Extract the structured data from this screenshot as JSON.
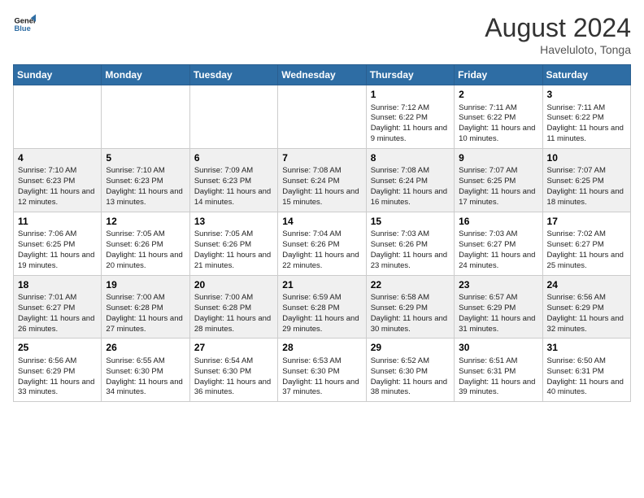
{
  "header": {
    "logo_line1": "General",
    "logo_line2": "Blue",
    "month_year": "August 2024",
    "location": "Haveluloto, Tonga"
  },
  "days_of_week": [
    "Sunday",
    "Monday",
    "Tuesday",
    "Wednesday",
    "Thursday",
    "Friday",
    "Saturday"
  ],
  "weeks": [
    [
      {
        "day": "",
        "info": ""
      },
      {
        "day": "",
        "info": ""
      },
      {
        "day": "",
        "info": ""
      },
      {
        "day": "",
        "info": ""
      },
      {
        "day": "1",
        "info": "Sunrise: 7:12 AM\nSunset: 6:22 PM\nDaylight: 11 hours\nand 9 minutes."
      },
      {
        "day": "2",
        "info": "Sunrise: 7:11 AM\nSunset: 6:22 PM\nDaylight: 11 hours\nand 10 minutes."
      },
      {
        "day": "3",
        "info": "Sunrise: 7:11 AM\nSunset: 6:22 PM\nDaylight: 11 hours\nand 11 minutes."
      }
    ],
    [
      {
        "day": "4",
        "info": "Sunrise: 7:10 AM\nSunset: 6:23 PM\nDaylight: 11 hours\nand 12 minutes."
      },
      {
        "day": "5",
        "info": "Sunrise: 7:10 AM\nSunset: 6:23 PM\nDaylight: 11 hours\nand 13 minutes."
      },
      {
        "day": "6",
        "info": "Sunrise: 7:09 AM\nSunset: 6:23 PM\nDaylight: 11 hours\nand 14 minutes."
      },
      {
        "day": "7",
        "info": "Sunrise: 7:08 AM\nSunset: 6:24 PM\nDaylight: 11 hours\nand 15 minutes."
      },
      {
        "day": "8",
        "info": "Sunrise: 7:08 AM\nSunset: 6:24 PM\nDaylight: 11 hours\nand 16 minutes."
      },
      {
        "day": "9",
        "info": "Sunrise: 7:07 AM\nSunset: 6:25 PM\nDaylight: 11 hours\nand 17 minutes."
      },
      {
        "day": "10",
        "info": "Sunrise: 7:07 AM\nSunset: 6:25 PM\nDaylight: 11 hours\nand 18 minutes."
      }
    ],
    [
      {
        "day": "11",
        "info": "Sunrise: 7:06 AM\nSunset: 6:25 PM\nDaylight: 11 hours\nand 19 minutes."
      },
      {
        "day": "12",
        "info": "Sunrise: 7:05 AM\nSunset: 6:26 PM\nDaylight: 11 hours\nand 20 minutes."
      },
      {
        "day": "13",
        "info": "Sunrise: 7:05 AM\nSunset: 6:26 PM\nDaylight: 11 hours\nand 21 minutes."
      },
      {
        "day": "14",
        "info": "Sunrise: 7:04 AM\nSunset: 6:26 PM\nDaylight: 11 hours\nand 22 minutes."
      },
      {
        "day": "15",
        "info": "Sunrise: 7:03 AM\nSunset: 6:26 PM\nDaylight: 11 hours\nand 23 minutes."
      },
      {
        "day": "16",
        "info": "Sunrise: 7:03 AM\nSunset: 6:27 PM\nDaylight: 11 hours\nand 24 minutes."
      },
      {
        "day": "17",
        "info": "Sunrise: 7:02 AM\nSunset: 6:27 PM\nDaylight: 11 hours\nand 25 minutes."
      }
    ],
    [
      {
        "day": "18",
        "info": "Sunrise: 7:01 AM\nSunset: 6:27 PM\nDaylight: 11 hours\nand 26 minutes."
      },
      {
        "day": "19",
        "info": "Sunrise: 7:00 AM\nSunset: 6:28 PM\nDaylight: 11 hours\nand 27 minutes."
      },
      {
        "day": "20",
        "info": "Sunrise: 7:00 AM\nSunset: 6:28 PM\nDaylight: 11 hours\nand 28 minutes."
      },
      {
        "day": "21",
        "info": "Sunrise: 6:59 AM\nSunset: 6:28 PM\nDaylight: 11 hours\nand 29 minutes."
      },
      {
        "day": "22",
        "info": "Sunrise: 6:58 AM\nSunset: 6:29 PM\nDaylight: 11 hours\nand 30 minutes."
      },
      {
        "day": "23",
        "info": "Sunrise: 6:57 AM\nSunset: 6:29 PM\nDaylight: 11 hours\nand 31 minutes."
      },
      {
        "day": "24",
        "info": "Sunrise: 6:56 AM\nSunset: 6:29 PM\nDaylight: 11 hours\nand 32 minutes."
      }
    ],
    [
      {
        "day": "25",
        "info": "Sunrise: 6:56 AM\nSunset: 6:29 PM\nDaylight: 11 hours\nand 33 minutes."
      },
      {
        "day": "26",
        "info": "Sunrise: 6:55 AM\nSunset: 6:30 PM\nDaylight: 11 hours\nand 34 minutes."
      },
      {
        "day": "27",
        "info": "Sunrise: 6:54 AM\nSunset: 6:30 PM\nDaylight: 11 hours\nand 36 minutes."
      },
      {
        "day": "28",
        "info": "Sunrise: 6:53 AM\nSunset: 6:30 PM\nDaylight: 11 hours\nand 37 minutes."
      },
      {
        "day": "29",
        "info": "Sunrise: 6:52 AM\nSunset: 6:30 PM\nDaylight: 11 hours\nand 38 minutes."
      },
      {
        "day": "30",
        "info": "Sunrise: 6:51 AM\nSunset: 6:31 PM\nDaylight: 11 hours\nand 39 minutes."
      },
      {
        "day": "31",
        "info": "Sunrise: 6:50 AM\nSunset: 6:31 PM\nDaylight: 11 hours\nand 40 minutes."
      }
    ]
  ]
}
